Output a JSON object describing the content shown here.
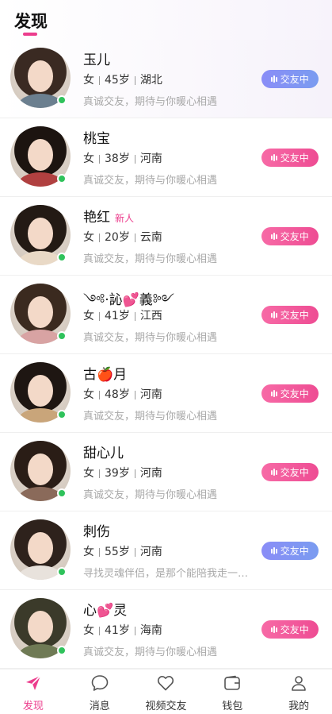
{
  "header": {
    "title": "发现"
  },
  "cta_label": "交友中",
  "colors": {
    "accent": "#ec3d8d",
    "online": "#2fc25b",
    "badge_pink": "#ee4c93",
    "badge_blue": "#7a9cf0"
  },
  "users": [
    {
      "name": "玉儿",
      "new_tag": "",
      "gender": "女",
      "age": "45岁",
      "region": "湖北",
      "bio": "真诚交友，期待与你暖心相遇",
      "badge_style": "blue",
      "hair": "#3a2a22",
      "clothes": "#6b7f8f"
    },
    {
      "name": "桃宝",
      "new_tag": "",
      "gender": "女",
      "age": "38岁",
      "region": "河南",
      "bio": "真诚交友，期待与你暖心相遇",
      "badge_style": "pink",
      "hair": "#1c1410",
      "clothes": "#b04040"
    },
    {
      "name": "艳红",
      "new_tag": "新人",
      "gender": "女",
      "age": "20岁",
      "region": "云南",
      "bio": "真诚交友，期待与你暖心相遇",
      "badge_style": "pink",
      "hair": "#231a14",
      "clothes": "#e9d9c6"
    },
    {
      "name": "༺·訫💕義༻",
      "new_tag": "",
      "gender": "女",
      "age": "41岁",
      "region": "江西",
      "bio": "真诚交友，期待与你暖心相遇",
      "badge_style": "pink",
      "hair": "#3b2a1f",
      "clothes": "#d8a3a3"
    },
    {
      "name": "古🍎月",
      "new_tag": "",
      "gender": "女",
      "age": "48岁",
      "region": "河南",
      "bio": "真诚交友，期待与你暖心相遇",
      "badge_style": "pink",
      "hair": "#1e1612",
      "clothes": "#c9a57a"
    },
    {
      "name": "甜心儿",
      "new_tag": "",
      "gender": "女",
      "age": "39岁",
      "region": "河南",
      "bio": "真诚交友，期待与你暖心相遇",
      "badge_style": "pink",
      "hair": "#2a1d16",
      "clothes": "#8a6a5a"
    },
    {
      "name": "刺伤",
      "new_tag": "",
      "gender": "女",
      "age": "55岁",
      "region": "河南",
      "bio": "寻找灵魂伴侣，是那个能陪我走一生的人",
      "badge_style": "blue",
      "hair": "#2e221c",
      "clothes": "#e8e2dc"
    },
    {
      "name": "心💕灵",
      "new_tag": "",
      "gender": "女",
      "age": "41岁",
      "region": "海南",
      "bio": "真诚交友，期待与你暖心相遇",
      "badge_style": "pink",
      "hair": "#3b3a2a",
      "clothes": "#6f7a55"
    }
  ],
  "tabbar": {
    "items": [
      {
        "label": "发现",
        "icon": "send-icon",
        "active": true
      },
      {
        "label": "消息",
        "icon": "chat-bubble-icon",
        "active": false
      },
      {
        "label": "视频交友",
        "icon": "heart-icon",
        "active": false
      },
      {
        "label": "钱包",
        "icon": "wallet-icon",
        "active": false
      },
      {
        "label": "我的",
        "icon": "user-icon",
        "active": false
      }
    ]
  }
}
